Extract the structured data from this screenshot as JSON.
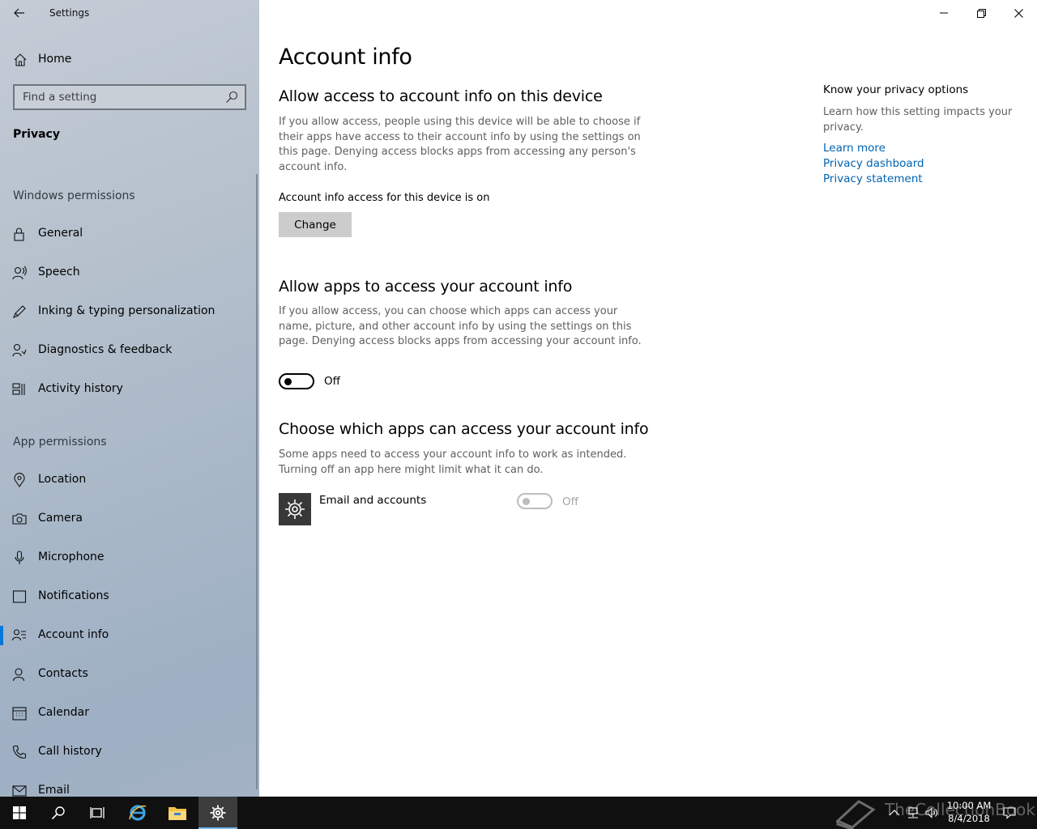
{
  "window": {
    "title": "Settings"
  },
  "sidebar": {
    "home_label": "Home",
    "search_placeholder": "Find a setting",
    "section_title": "Privacy",
    "windows_permissions_header": "Windows permissions",
    "windows_permissions": [
      {
        "label": "General",
        "icon": "lock-icon"
      },
      {
        "label": "Speech",
        "icon": "speech-icon"
      },
      {
        "label": "Inking & typing personalization",
        "icon": "inking-icon"
      },
      {
        "label": "Diagnostics & feedback",
        "icon": "diagnostics-icon"
      },
      {
        "label": "Activity history",
        "icon": "activity-history-icon"
      }
    ],
    "app_permissions_header": "App permissions",
    "app_permissions": [
      {
        "label": "Location",
        "icon": "location-icon"
      },
      {
        "label": "Camera",
        "icon": "camera-icon"
      },
      {
        "label": "Microphone",
        "icon": "microphone-icon"
      },
      {
        "label": "Notifications",
        "icon": "notifications-icon"
      },
      {
        "label": "Account info",
        "icon": "account-info-icon",
        "selected": true
      },
      {
        "label": "Contacts",
        "icon": "contacts-icon"
      },
      {
        "label": "Calendar",
        "icon": "calendar-icon"
      },
      {
        "label": "Call history",
        "icon": "call-history-icon"
      },
      {
        "label": "Email",
        "icon": "email-icon"
      }
    ]
  },
  "main": {
    "page_title": "Account info",
    "device_section": {
      "heading": "Allow access to account info on this device",
      "description": "If you allow access, people using this device will be able to choose if their apps have access to their account info by using the settings on this page. Denying access blocks apps from accessing any person's account info.",
      "status": "Account info access for this device is on",
      "button_label": "Change"
    },
    "apps_section": {
      "heading": "Allow apps to access your account info",
      "description": "If you allow access, you can choose which apps can access your name, picture, and other account info by using the settings on this page. Denying access blocks apps from accessing your account info.",
      "toggle_state": "Off"
    },
    "choose_section": {
      "heading": "Choose which apps can access your account info",
      "description": "Some apps need to access your account info to work as intended. Turning off an app here might limit what it can do.",
      "apps": [
        {
          "name": "Email and accounts",
          "toggle_state": "Off",
          "enabled": false,
          "icon": "gear-icon"
        }
      ]
    },
    "side_panel": {
      "title": "Know your privacy options",
      "description": "Learn how this setting impacts your privacy.",
      "links": [
        "Learn more",
        "Privacy dashboard",
        "Privacy statement"
      ]
    }
  },
  "taskbar": {
    "time": "10:00 AM",
    "date": "8/4/2018",
    "watermark": "TheCollectionBook",
    "active_app": "Settings"
  },
  "colors": {
    "accent": "#0078d7",
    "link": "#0063b1",
    "taskbar": "#101010"
  }
}
